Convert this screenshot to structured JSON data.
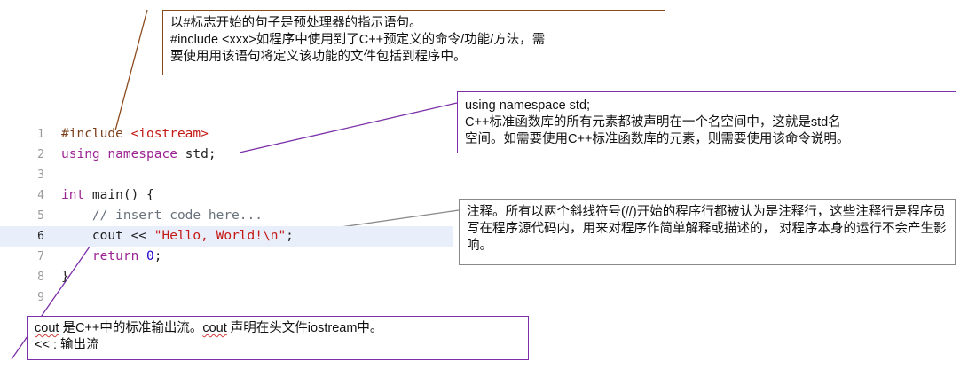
{
  "annotations": {
    "include": {
      "lines": [
        "以#标志开始的句子是预处理器的指示语句。",
        "#include <xxx>如程序中使用到了C++预定义的命令/功能/方法，需",
        "要使用用该语句将定义该功能的文件包括到程序中。"
      ]
    },
    "namespace": {
      "lines": [
        "using namespace std;",
        "C++标准函数库的所有元素都被声明在一个名空间中，这就是std名",
        "空间。如需要使用C++标准函数库的元素，则需要使用该命令说明。"
      ]
    },
    "comment": {
      "text": "注释。所有以两个斜线符号(//)开始的程序行都被认为是注释行，这些注释行是程序员写在程序源代码内，用来对程序作简单解释或描述的， 对程序本身的运行不会产生影响。"
    },
    "cout": {
      "word": "cout",
      "line1_mid": " 是C++中的标准输出流。",
      "line1_end": " 声明在头文件iostream中。",
      "line2": "<< : 输出流"
    }
  },
  "code": {
    "active_line": 6,
    "lines": [
      {
        "num": "1",
        "parts": [
          {
            "t": "#include ",
            "c": "kw-pre"
          },
          {
            "t": "<iostream>",
            "c": "kw-str"
          }
        ]
      },
      {
        "num": "2",
        "parts": [
          {
            "t": "using namespace",
            "c": "kw-purple"
          },
          {
            "t": " std;",
            "c": ""
          }
        ]
      },
      {
        "num": "3",
        "parts": []
      },
      {
        "num": "4",
        "parts": [
          {
            "t": "int",
            "c": "kw-purple"
          },
          {
            "t": " main() {",
            "c": ""
          }
        ]
      },
      {
        "num": "5",
        "parts": [
          {
            "t": "    // insert code here...",
            "c": "kw-cmt"
          }
        ]
      },
      {
        "num": "6",
        "parts": [
          {
            "t": "    cout << ",
            "c": ""
          },
          {
            "t": "\"Hello, World!\\n\"",
            "c": "kw-str"
          },
          {
            "t": ";",
            "c": ""
          }
        ]
      },
      {
        "num": "7",
        "parts": [
          {
            "t": "    ",
            "c": ""
          },
          {
            "t": "return",
            "c": "kw-purple"
          },
          {
            "t": " ",
            "c": ""
          },
          {
            "t": "0",
            "c": "kw-num"
          },
          {
            "t": ";",
            "c": ""
          }
        ]
      },
      {
        "num": "8",
        "parts": [
          {
            "t": "}",
            "c": ""
          }
        ]
      },
      {
        "num": "9",
        "parts": []
      }
    ]
  },
  "colors": {
    "brown": "#8b4a1c",
    "purple": "#7b2fa8",
    "gray": "#888888"
  }
}
